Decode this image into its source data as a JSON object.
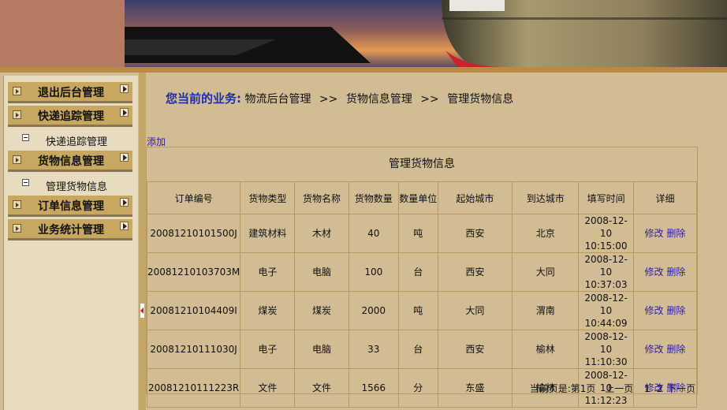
{
  "sidebar": {
    "items": [
      {
        "label": "退出后台管理"
      },
      {
        "label": "快递追踪管理",
        "sub": "快递追踪管理"
      },
      {
        "label": "货物信息管理",
        "sub": "管理货物信息"
      },
      {
        "label": "订单信息管理"
      },
      {
        "label": "业务统计管理"
      }
    ]
  },
  "breadcrumb": {
    "label": "您当前的业务:",
    "sep": ">>",
    "path": [
      "物流后台管理",
      "货物信息管理",
      "管理货物信息"
    ]
  },
  "main": {
    "add_label": "添加",
    "table_title": "管理货物信息",
    "columns": [
      "订单编号",
      "货物类型",
      "货物名称",
      "货物数量",
      "数量单位",
      "起始城市",
      "到达城市",
      "填写时间",
      "详细"
    ],
    "rows": [
      {
        "id": "20081210101500J",
        "type": "建筑材料",
        "name": "木材",
        "qty": "40",
        "unit": "吨",
        "from": "西安",
        "to": "北京",
        "date": "2008-12-10",
        "time": "10:15:00"
      },
      {
        "id": "20081210103703M",
        "type": "电子",
        "name": "电脑",
        "qty": "100",
        "unit": "台",
        "from": "西安",
        "to": "大同",
        "date": "2008-12-10",
        "time": "10:37:03"
      },
      {
        "id": "20081210104409I",
        "type": "煤炭",
        "name": "煤炭",
        "qty": "2000",
        "unit": "吨",
        "from": "大同",
        "to": "渭南",
        "date": "2008-12-10",
        "time": "10:44:09"
      },
      {
        "id": "20081210111030J",
        "type": "电子",
        "name": "电脑",
        "qty": "33",
        "unit": "台",
        "from": "西安",
        "to": "榆林",
        "date": "2008-12-10",
        "time": "11:10:30"
      },
      {
        "id": "20081210111223R",
        "type": "文件",
        "name": "文件",
        "qty": "1566",
        "unit": "分",
        "from": "东盛",
        "to": "榆林",
        "date": "2008-12-10",
        "time": "11:12:23"
      }
    ],
    "edit_label": "修改",
    "delete_label": "删除"
  },
  "pager": {
    "current": "当前页是:第1页",
    "prev": "上一页",
    "pages": [
      "1",
      "2"
    ],
    "next": "下一页"
  }
}
